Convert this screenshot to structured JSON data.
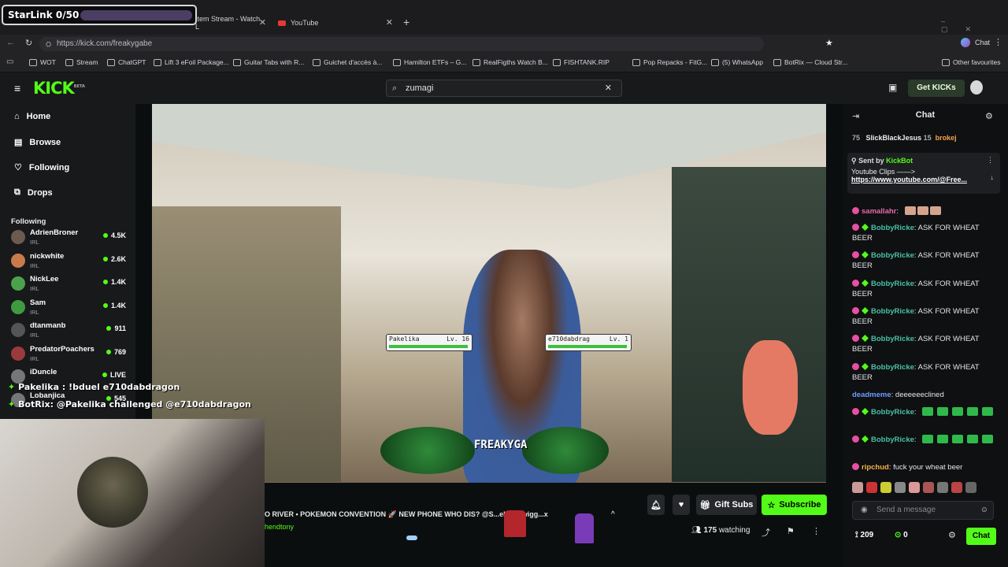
{
  "overlay": {
    "starlink": "StarLink 0/50"
  },
  "browser": {
    "tabs": [
      {
        "label": "Item Stream - Watch L"
      },
      {
        "label": "YouTube"
      }
    ],
    "url": "https://kick.com/freakygabe",
    "chat_label": "Chat",
    "bookmarks": [
      "WOT",
      "Stream",
      "ChatGPT",
      "Lift 3 eFoil Package...",
      "Guitar Tabs with R...",
      "Guichet d'accès à...",
      "Hamilton ETFs – G...",
      "RealFigths Watch B...",
      "FISHTANK.RIP",
      "Pop Repacks - FitG...",
      "(5) WhatsApp",
      "BotRix — Cloud Str..."
    ],
    "other_favourites": "Other favourites"
  },
  "kick": {
    "logo": "KICK",
    "logo_sup": "BETA",
    "search_value": "zumagi",
    "get_kicks": "Get KICKs",
    "nav": [
      {
        "label": "Home",
        "icon": "home-icon"
      },
      {
        "label": "Browse",
        "icon": "browse-icon"
      },
      {
        "label": "Following",
        "icon": "heart-icon"
      },
      {
        "label": "Drops",
        "icon": "drops-icon"
      }
    ],
    "following_title": "Following",
    "following": [
      {
        "name": "AdrienBroner",
        "cat": "IRL",
        "viewers": "4.5K",
        "color": "#6b5a4e"
      },
      {
        "name": "nickwhite",
        "cat": "IRL",
        "viewers": "2.6K",
        "color": "#c77b4a"
      },
      {
        "name": "NickLee",
        "cat": "IRL",
        "viewers": "1.4K",
        "color": "#4aa34a"
      },
      {
        "name": "Sam",
        "cat": "IRL",
        "viewers": "1.4K",
        "color": "#3f9b3f"
      },
      {
        "name": "dtanmanb",
        "cat": "IRL",
        "viewers": "911",
        "color": "#555"
      },
      {
        "name": "PredatorPoachers",
        "cat": "IRL",
        "viewers": "769",
        "color": "#9a3a3a"
      },
      {
        "name": "iDuncle",
        "cat": "",
        "viewers": "LIVE",
        "color": "#777"
      },
      {
        "name": "Lobanjica",
        "cat": "",
        "viewers": "545",
        "color": "#777"
      }
    ]
  },
  "stream_overlay": {
    "duel_line1": "Pakelika : !bduel e710dabdragon",
    "duel_line2_user": "BotRix",
    "duel_line2_text": ": @Pakelika challenged @e710dabdragon",
    "left_trainer": "Pakelika",
    "left_level": "Lv. 16",
    "right_trainer": "e710dabdrag",
    "right_level": "Lv. 1",
    "stream_name": "FREAKYGA"
  },
  "below_video": {
    "ticker": "O RIVER • POKEMON CONVENTION 🚀 NEW PHONE WHO DIS? @S...els @Twigg...x",
    "ticker2": "hendtony",
    "gift_subs": "Gift Subs",
    "subscribe": "Subscribe",
    "watching_count": "175",
    "watching_label": "watching"
  },
  "chat": {
    "title": "Chat",
    "top_users": [
      {
        "rank": "75",
        "name": ""
      },
      {
        "name": "SlickBlackJesus",
        "count": "15"
      },
      {
        "name": "brokej"
      }
    ],
    "pinned": {
      "sent_by": "Sent by",
      "sender": "KickBot",
      "text": "Youtube Clips ——>",
      "link": "https://www.youtube.com/@Free..."
    },
    "messages": [
      {
        "user": "samallahr",
        "text": "",
        "emote": "face",
        "color": "#e66aa8"
      },
      {
        "user": "BobbyRicke",
        "text": "ASK FOR WHEAT BEER",
        "color": "#49c0a4"
      },
      {
        "user": "BobbyRicke",
        "text": "ASK FOR WHEAT BEER",
        "color": "#49c0a4"
      },
      {
        "user": "BobbyRicke",
        "text": "ASK FOR WHEAT BEER",
        "color": "#49c0a4"
      },
      {
        "user": "BobbyRicke",
        "text": "ASK FOR WHEAT BEER",
        "color": "#49c0a4"
      },
      {
        "user": "BobbyRicke",
        "text": "ASK FOR WHEAT BEER",
        "color": "#49c0a4"
      },
      {
        "user": "BobbyRicke",
        "text": "ASK FOR WHEAT BEER",
        "color": "#49c0a4"
      },
      {
        "user": "deadmeme",
        "text": "deeeeeeclined",
        "color": "#6f9cff"
      },
      {
        "user": "BobbyRicke",
        "text": "",
        "emote": "green",
        "color": "#49c0a4"
      },
      {
        "user": "BobbyRicke",
        "text": "",
        "emote": "green",
        "color": "#49c0a4"
      },
      {
        "user": "ripchud",
        "text": "fuck your wheat beer",
        "color": "#f5b14b"
      }
    ],
    "send_placeholder": "Send a message",
    "points": "209",
    "kicks": "0",
    "chat_button": "Chat"
  },
  "colors": {
    "accent": "#53fc18",
    "bg": "#0b0e0f",
    "panel": "#18191b"
  }
}
